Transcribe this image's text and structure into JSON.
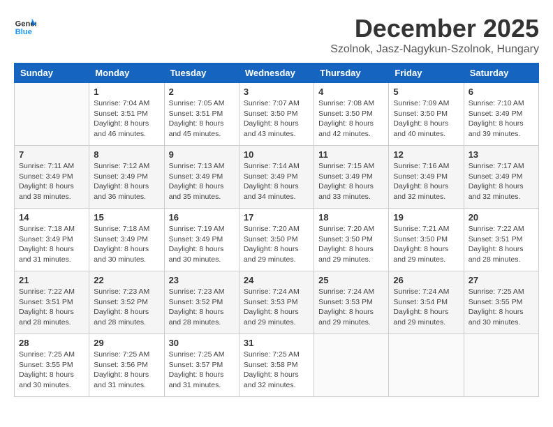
{
  "header": {
    "logo": {
      "general": "General",
      "blue": "Blue"
    },
    "title": "December 2025",
    "location": "Szolnok, Jasz-Nagykun-Szolnok, Hungary"
  },
  "calendar": {
    "days_of_week": [
      "Sunday",
      "Monday",
      "Tuesday",
      "Wednesday",
      "Thursday",
      "Friday",
      "Saturday"
    ],
    "weeks": [
      [
        {
          "day": "",
          "sunrise": "",
          "sunset": "",
          "daylight": ""
        },
        {
          "day": "1",
          "sunrise": "Sunrise: 7:04 AM",
          "sunset": "Sunset: 3:51 PM",
          "daylight": "Daylight: 8 hours and 46 minutes."
        },
        {
          "day": "2",
          "sunrise": "Sunrise: 7:05 AM",
          "sunset": "Sunset: 3:51 PM",
          "daylight": "Daylight: 8 hours and 45 minutes."
        },
        {
          "day": "3",
          "sunrise": "Sunrise: 7:07 AM",
          "sunset": "Sunset: 3:50 PM",
          "daylight": "Daylight: 8 hours and 43 minutes."
        },
        {
          "day": "4",
          "sunrise": "Sunrise: 7:08 AM",
          "sunset": "Sunset: 3:50 PM",
          "daylight": "Daylight: 8 hours and 42 minutes."
        },
        {
          "day": "5",
          "sunrise": "Sunrise: 7:09 AM",
          "sunset": "Sunset: 3:50 PM",
          "daylight": "Daylight: 8 hours and 40 minutes."
        },
        {
          "day": "6",
          "sunrise": "Sunrise: 7:10 AM",
          "sunset": "Sunset: 3:49 PM",
          "daylight": "Daylight: 8 hours and 39 minutes."
        }
      ],
      [
        {
          "day": "7",
          "sunrise": "Sunrise: 7:11 AM",
          "sunset": "Sunset: 3:49 PM",
          "daylight": "Daylight: 8 hours and 38 minutes."
        },
        {
          "day": "8",
          "sunrise": "Sunrise: 7:12 AM",
          "sunset": "Sunset: 3:49 PM",
          "daylight": "Daylight: 8 hours and 36 minutes."
        },
        {
          "day": "9",
          "sunrise": "Sunrise: 7:13 AM",
          "sunset": "Sunset: 3:49 PM",
          "daylight": "Daylight: 8 hours and 35 minutes."
        },
        {
          "day": "10",
          "sunrise": "Sunrise: 7:14 AM",
          "sunset": "Sunset: 3:49 PM",
          "daylight": "Daylight: 8 hours and 34 minutes."
        },
        {
          "day": "11",
          "sunrise": "Sunrise: 7:15 AM",
          "sunset": "Sunset: 3:49 PM",
          "daylight": "Daylight: 8 hours and 33 minutes."
        },
        {
          "day": "12",
          "sunrise": "Sunrise: 7:16 AM",
          "sunset": "Sunset: 3:49 PM",
          "daylight": "Daylight: 8 hours and 32 minutes."
        },
        {
          "day": "13",
          "sunrise": "Sunrise: 7:17 AM",
          "sunset": "Sunset: 3:49 PM",
          "daylight": "Daylight: 8 hours and 32 minutes."
        }
      ],
      [
        {
          "day": "14",
          "sunrise": "Sunrise: 7:18 AM",
          "sunset": "Sunset: 3:49 PM",
          "daylight": "Daylight: 8 hours and 31 minutes."
        },
        {
          "day": "15",
          "sunrise": "Sunrise: 7:18 AM",
          "sunset": "Sunset: 3:49 PM",
          "daylight": "Daylight: 8 hours and 30 minutes."
        },
        {
          "day": "16",
          "sunrise": "Sunrise: 7:19 AM",
          "sunset": "Sunset: 3:49 PM",
          "daylight": "Daylight: 8 hours and 30 minutes."
        },
        {
          "day": "17",
          "sunrise": "Sunrise: 7:20 AM",
          "sunset": "Sunset: 3:50 PM",
          "daylight": "Daylight: 8 hours and 29 minutes."
        },
        {
          "day": "18",
          "sunrise": "Sunrise: 7:20 AM",
          "sunset": "Sunset: 3:50 PM",
          "daylight": "Daylight: 8 hours and 29 minutes."
        },
        {
          "day": "19",
          "sunrise": "Sunrise: 7:21 AM",
          "sunset": "Sunset: 3:50 PM",
          "daylight": "Daylight: 8 hours and 29 minutes."
        },
        {
          "day": "20",
          "sunrise": "Sunrise: 7:22 AM",
          "sunset": "Sunset: 3:51 PM",
          "daylight": "Daylight: 8 hours and 28 minutes."
        }
      ],
      [
        {
          "day": "21",
          "sunrise": "Sunrise: 7:22 AM",
          "sunset": "Sunset: 3:51 PM",
          "daylight": "Daylight: 8 hours and 28 minutes."
        },
        {
          "day": "22",
          "sunrise": "Sunrise: 7:23 AM",
          "sunset": "Sunset: 3:52 PM",
          "daylight": "Daylight: 8 hours and 28 minutes."
        },
        {
          "day": "23",
          "sunrise": "Sunrise: 7:23 AM",
          "sunset": "Sunset: 3:52 PM",
          "daylight": "Daylight: 8 hours and 28 minutes."
        },
        {
          "day": "24",
          "sunrise": "Sunrise: 7:24 AM",
          "sunset": "Sunset: 3:53 PM",
          "daylight": "Daylight: 8 hours and 29 minutes."
        },
        {
          "day": "25",
          "sunrise": "Sunrise: 7:24 AM",
          "sunset": "Sunset: 3:53 PM",
          "daylight": "Daylight: 8 hours and 29 minutes."
        },
        {
          "day": "26",
          "sunrise": "Sunrise: 7:24 AM",
          "sunset": "Sunset: 3:54 PM",
          "daylight": "Daylight: 8 hours and 29 minutes."
        },
        {
          "day": "27",
          "sunrise": "Sunrise: 7:25 AM",
          "sunset": "Sunset: 3:55 PM",
          "daylight": "Daylight: 8 hours and 30 minutes."
        }
      ],
      [
        {
          "day": "28",
          "sunrise": "Sunrise: 7:25 AM",
          "sunset": "Sunset: 3:55 PM",
          "daylight": "Daylight: 8 hours and 30 minutes."
        },
        {
          "day": "29",
          "sunrise": "Sunrise: 7:25 AM",
          "sunset": "Sunset: 3:56 PM",
          "daylight": "Daylight: 8 hours and 31 minutes."
        },
        {
          "day": "30",
          "sunrise": "Sunrise: 7:25 AM",
          "sunset": "Sunset: 3:57 PM",
          "daylight": "Daylight: 8 hours and 31 minutes."
        },
        {
          "day": "31",
          "sunrise": "Sunrise: 7:25 AM",
          "sunset": "Sunset: 3:58 PM",
          "daylight": "Daylight: 8 hours and 32 minutes."
        },
        {
          "day": "",
          "sunrise": "",
          "sunset": "",
          "daylight": ""
        },
        {
          "day": "",
          "sunrise": "",
          "sunset": "",
          "daylight": ""
        },
        {
          "day": "",
          "sunrise": "",
          "sunset": "",
          "daylight": ""
        }
      ]
    ]
  }
}
